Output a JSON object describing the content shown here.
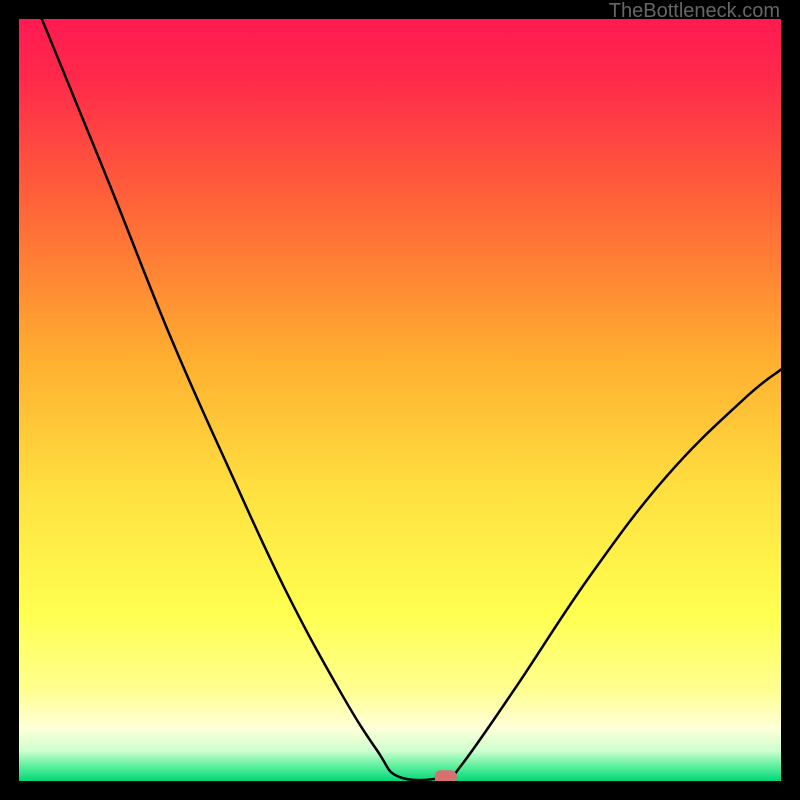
{
  "watermark": "TheBottleneck.com",
  "chart_data": {
    "type": "line",
    "title": "",
    "xlabel": "",
    "ylabel": "",
    "xlim": [
      0,
      100
    ],
    "ylim": [
      0,
      100
    ],
    "gradient_colors": {
      "top": "#ff1a52",
      "upper_mid": "#ff7a33",
      "mid": "#ffd633",
      "lower_mid": "#ffff66",
      "near_bottom": "#ffffcc",
      "bottom": "#00e080"
    },
    "curve_points": [
      {
        "x": 3,
        "y": 100
      },
      {
        "x": 12,
        "y": 78
      },
      {
        "x": 20,
        "y": 58
      },
      {
        "x": 28,
        "y": 40
      },
      {
        "x": 35,
        "y": 25
      },
      {
        "x": 42,
        "y": 12
      },
      {
        "x": 47,
        "y": 4
      },
      {
        "x": 50,
        "y": 0.5
      },
      {
        "x": 56,
        "y": 0.5
      },
      {
        "x": 58,
        "y": 2
      },
      {
        "x": 65,
        "y": 12
      },
      {
        "x": 75,
        "y": 27
      },
      {
        "x": 85,
        "y": 40
      },
      {
        "x": 95,
        "y": 50
      },
      {
        "x": 100,
        "y": 54
      }
    ],
    "marker": {
      "x": 56,
      "y": 0.5,
      "color": "#d87070"
    }
  }
}
